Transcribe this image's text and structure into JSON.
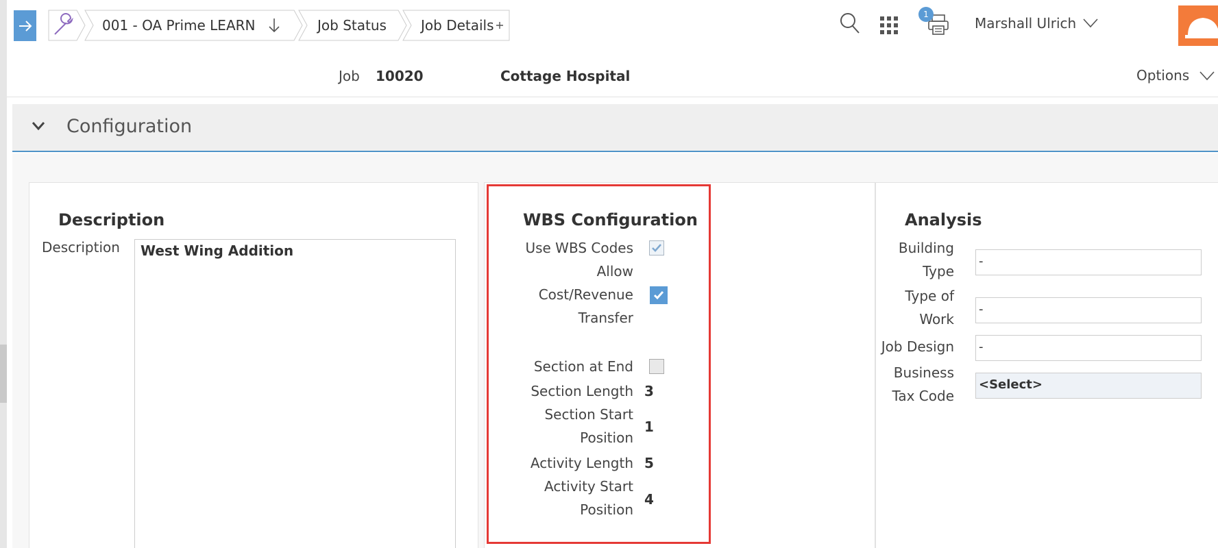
{
  "breadcrumb": {
    "company": "001 - OA Prime LEARN",
    "status": "Job Status",
    "details": "Job Details"
  },
  "header": {
    "notification_count": "1",
    "user_name": "Marshall Ulrich"
  },
  "job": {
    "label": "Job",
    "number": "10020",
    "name": "Cottage Hospital",
    "options_label": "Options"
  },
  "section": {
    "title": "Configuration"
  },
  "description_panel": {
    "title": "Description",
    "field_label": "Description",
    "value": "West Wing Addition"
  },
  "wbs_panel": {
    "title": "WBS Configuration",
    "use_wbs_codes_label": "Use WBS Codes",
    "use_wbs_codes_checked": true,
    "allow_transfer_label_line1": "Allow",
    "allow_transfer_label_line2": "Cost/Revenue",
    "allow_transfer_label_line3": "Transfer",
    "allow_transfer_checked": true,
    "section_at_end_label": "Section at End",
    "section_at_end_checked": false,
    "section_length_label": "Section Length",
    "section_length_value": "3",
    "section_start_label_line1": "Section Start",
    "section_start_label_line2": "Position",
    "section_start_value": "1",
    "activity_length_label": "Activity Length",
    "activity_length_value": "5",
    "activity_start_label_line1": "Activity Start",
    "activity_start_label_line2": "Position",
    "activity_start_value": "4"
  },
  "analysis_panel": {
    "title": "Analysis",
    "building_type_label_line1": "Building",
    "building_type_label_line2": "Type",
    "building_type_value": "-",
    "type_of_work_label_line1": "Type of",
    "type_of_work_label_line2": "Work",
    "type_of_work_value": "-",
    "job_design_label": "Job Design",
    "job_design_value": "-",
    "business_tax_label_line1": "Business",
    "business_tax_label_line2": "Tax Code",
    "business_tax_value": "<Select>"
  },
  "colors": {
    "accent_blue": "#5b9bd5",
    "brand_orange": "#f37b3a",
    "highlight_red": "#e53935"
  },
  "icons": [
    "arrow-right-icon",
    "wrench-icon",
    "arrow-down-icon",
    "plus-icon",
    "search-icon",
    "apps-grid-icon",
    "printer-icon",
    "chevron-down-icon",
    "hard-hat-logo"
  ]
}
